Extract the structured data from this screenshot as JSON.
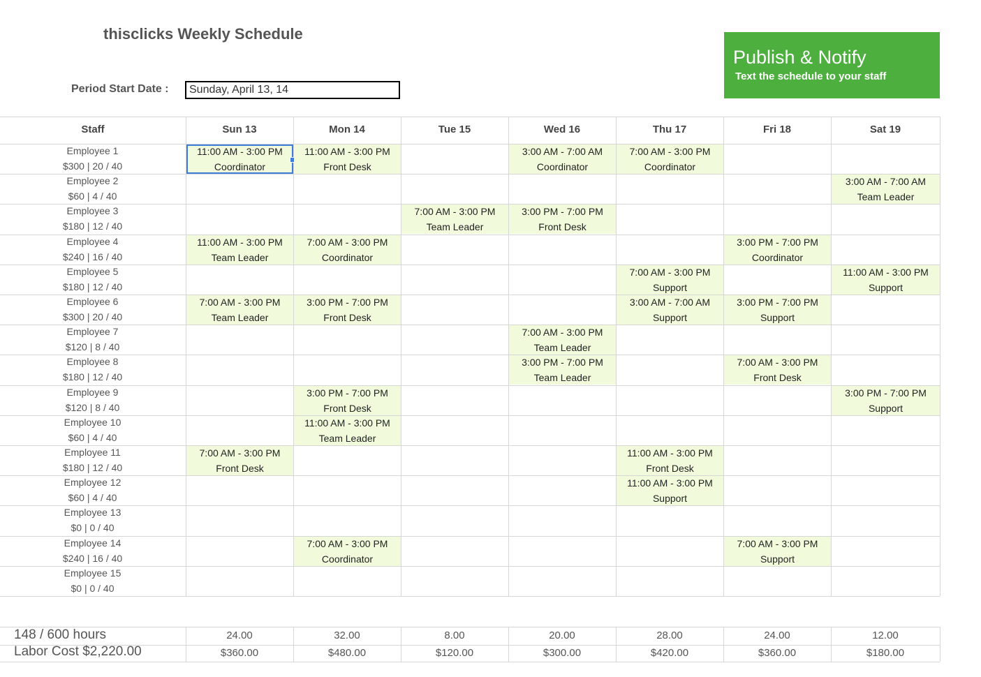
{
  "header": {
    "title": "thisclicks Weekly Schedule",
    "period_label": "Period Start Date :",
    "period_value": "Sunday, April 13, 14"
  },
  "publish": {
    "title": "Publish & Notify",
    "subtitle": "Text the schedule to your staff",
    "color": "#4caf3e"
  },
  "columns": [
    "Staff",
    "Sun 13",
    "Mon 14",
    "Tue 15",
    "Wed 16",
    "Thu 17",
    "Fri 18",
    "Sat 19"
  ],
  "staff": [
    {
      "name": "Employee 1",
      "summary": "$300 | 20 / 40"
    },
    {
      "name": "Employee 2",
      "summary": "$60 | 4 / 40"
    },
    {
      "name": "Employee 3",
      "summary": "$180 | 12 / 40"
    },
    {
      "name": "Employee 4",
      "summary": "$240 | 16 / 40"
    },
    {
      "name": "Employee 5",
      "summary": "$180 | 12 / 40"
    },
    {
      "name": "Employee 6",
      "summary": "$300 | 20 / 40"
    },
    {
      "name": "Employee 7",
      "summary": "$120 | 8 / 40"
    },
    {
      "name": "Employee 8",
      "summary": "$180 | 12 / 40"
    },
    {
      "name": "Employee 9",
      "summary": "$120 | 8 / 40"
    },
    {
      "name": "Employee 10",
      "summary": "$60 | 4 / 40"
    },
    {
      "name": "Employee 11",
      "summary": "$180 | 12 / 40"
    },
    {
      "name": "Employee 12",
      "summary": "$60 | 4 / 40"
    },
    {
      "name": "Employee 13",
      "summary": "$0 | 0 / 40"
    },
    {
      "name": "Employee 14",
      "summary": "$240 | 16 / 40"
    },
    {
      "name": "Employee 15",
      "summary": "$0 | 0 / 40"
    }
  ],
  "shifts": [
    {
      "row": 0,
      "day": 0,
      "time": "11:00 AM - 3:00 PM",
      "role": "Coordinator"
    },
    {
      "row": 0,
      "day": 1,
      "time": "11:00 AM - 3:00 PM",
      "role": "Front Desk"
    },
    {
      "row": 0,
      "day": 3,
      "time": "3:00 AM - 7:00 AM",
      "role": "Coordinator"
    },
    {
      "row": 0,
      "day": 4,
      "time": "7:00 AM - 3:00 PM",
      "role": "Coordinator"
    },
    {
      "row": 1,
      "day": 6,
      "time": "3:00 AM - 7:00 AM",
      "role": "Team Leader"
    },
    {
      "row": 2,
      "day": 2,
      "time": "7:00 AM - 3:00 PM",
      "role": "Team Leader"
    },
    {
      "row": 2,
      "day": 3,
      "time": "3:00 PM - 7:00 PM",
      "role": "Front Desk"
    },
    {
      "row": 3,
      "day": 0,
      "time": "11:00 AM - 3:00 PM",
      "role": "Team Leader"
    },
    {
      "row": 3,
      "day": 1,
      "time": "7:00 AM - 3:00 PM",
      "role": "Coordinator"
    },
    {
      "row": 3,
      "day": 5,
      "time": "3:00 PM - 7:00 PM",
      "role": "Coordinator"
    },
    {
      "row": 4,
      "day": 4,
      "time": "7:00 AM - 3:00 PM",
      "role": "Support"
    },
    {
      "row": 4,
      "day": 6,
      "time": "11:00 AM - 3:00 PM",
      "role": "Support"
    },
    {
      "row": 5,
      "day": 0,
      "time": "7:00 AM - 3:00 PM",
      "role": "Team Leader"
    },
    {
      "row": 5,
      "day": 1,
      "time": "3:00 PM - 7:00 PM",
      "role": "Front Desk"
    },
    {
      "row": 5,
      "day": 4,
      "time": "3:00 AM - 7:00 AM",
      "role": "Support"
    },
    {
      "row": 5,
      "day": 5,
      "time": "3:00 PM - 7:00 PM",
      "role": "Support"
    },
    {
      "row": 6,
      "day": 3,
      "time": "7:00 AM - 3:00 PM",
      "role": "Team Leader"
    },
    {
      "row": 7,
      "day": 3,
      "time": "3:00 PM - 7:00 PM",
      "role": "Team Leader"
    },
    {
      "row": 7,
      "day": 5,
      "time": "7:00 AM - 3:00 PM",
      "role": "Front Desk"
    },
    {
      "row": 8,
      "day": 1,
      "time": "3:00 PM - 7:00 PM",
      "role": "Front Desk"
    },
    {
      "row": 8,
      "day": 6,
      "time": "3:00 PM - 7:00 PM",
      "role": "Support"
    },
    {
      "row": 9,
      "day": 1,
      "time": "11:00 AM - 3:00 PM",
      "role": "Team Leader"
    },
    {
      "row": 10,
      "day": 0,
      "time": "7:00 AM - 3:00 PM",
      "role": "Front Desk"
    },
    {
      "row": 10,
      "day": 4,
      "time": "11:00 AM - 3:00 PM",
      "role": "Front Desk"
    },
    {
      "row": 11,
      "day": 4,
      "time": "11:00 AM - 3:00 PM",
      "role": "Support"
    },
    {
      "row": 13,
      "day": 1,
      "time": "7:00 AM - 3:00 PM",
      "role": "Coordinator"
    },
    {
      "row": 13,
      "day": 5,
      "time": "7:00 AM - 3:00 PM",
      "role": "Support"
    }
  ],
  "selected_cell": {
    "row": 0,
    "day": 0
  },
  "totals": {
    "hours_label": "148 / 600 hours",
    "cost_label": "Labor Cost $2,220.00",
    "day_hours": [
      "24.00",
      "32.00",
      "8.00",
      "20.00",
      "28.00",
      "24.00",
      "12.00"
    ],
    "day_costs": [
      "$360.00",
      "$480.00",
      "$120.00",
      "$300.00",
      "$420.00",
      "$360.00",
      "$180.00"
    ]
  },
  "colors": {
    "shift_fill": "#f1fbdc",
    "grid_line": "#d6d6d6",
    "selection": "#3b7dd8"
  }
}
